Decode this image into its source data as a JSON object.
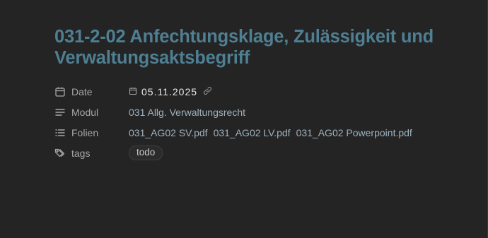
{
  "note": {
    "title": "031-2-02 Anfechtungsklage, Zulässigkeit und Verwaltungsaktsbegriff"
  },
  "properties": {
    "date": {
      "key": "Date",
      "value": "05.11.2025",
      "icon": "calendar-icon"
    },
    "modul": {
      "key": "Modul",
      "value": "031 Allg. Verwaltungsrecht",
      "icon": "text-lines-icon"
    },
    "folien": {
      "key": "Folien",
      "icon": "list-icon",
      "files": [
        "031_AG02 SV.pdf",
        "031_AG02 LV.pdf",
        "031_AG02 Powerpoint.pdf"
      ]
    },
    "tags": {
      "key": "tags",
      "icon": "tags-icon",
      "values": [
        "todo"
      ]
    }
  },
  "colors": {
    "background": "#242424",
    "title": "#4e7f92",
    "key_text": "#a6a6a6",
    "value_text": "#9fb2bf",
    "date_text": "#e8e8e8"
  }
}
